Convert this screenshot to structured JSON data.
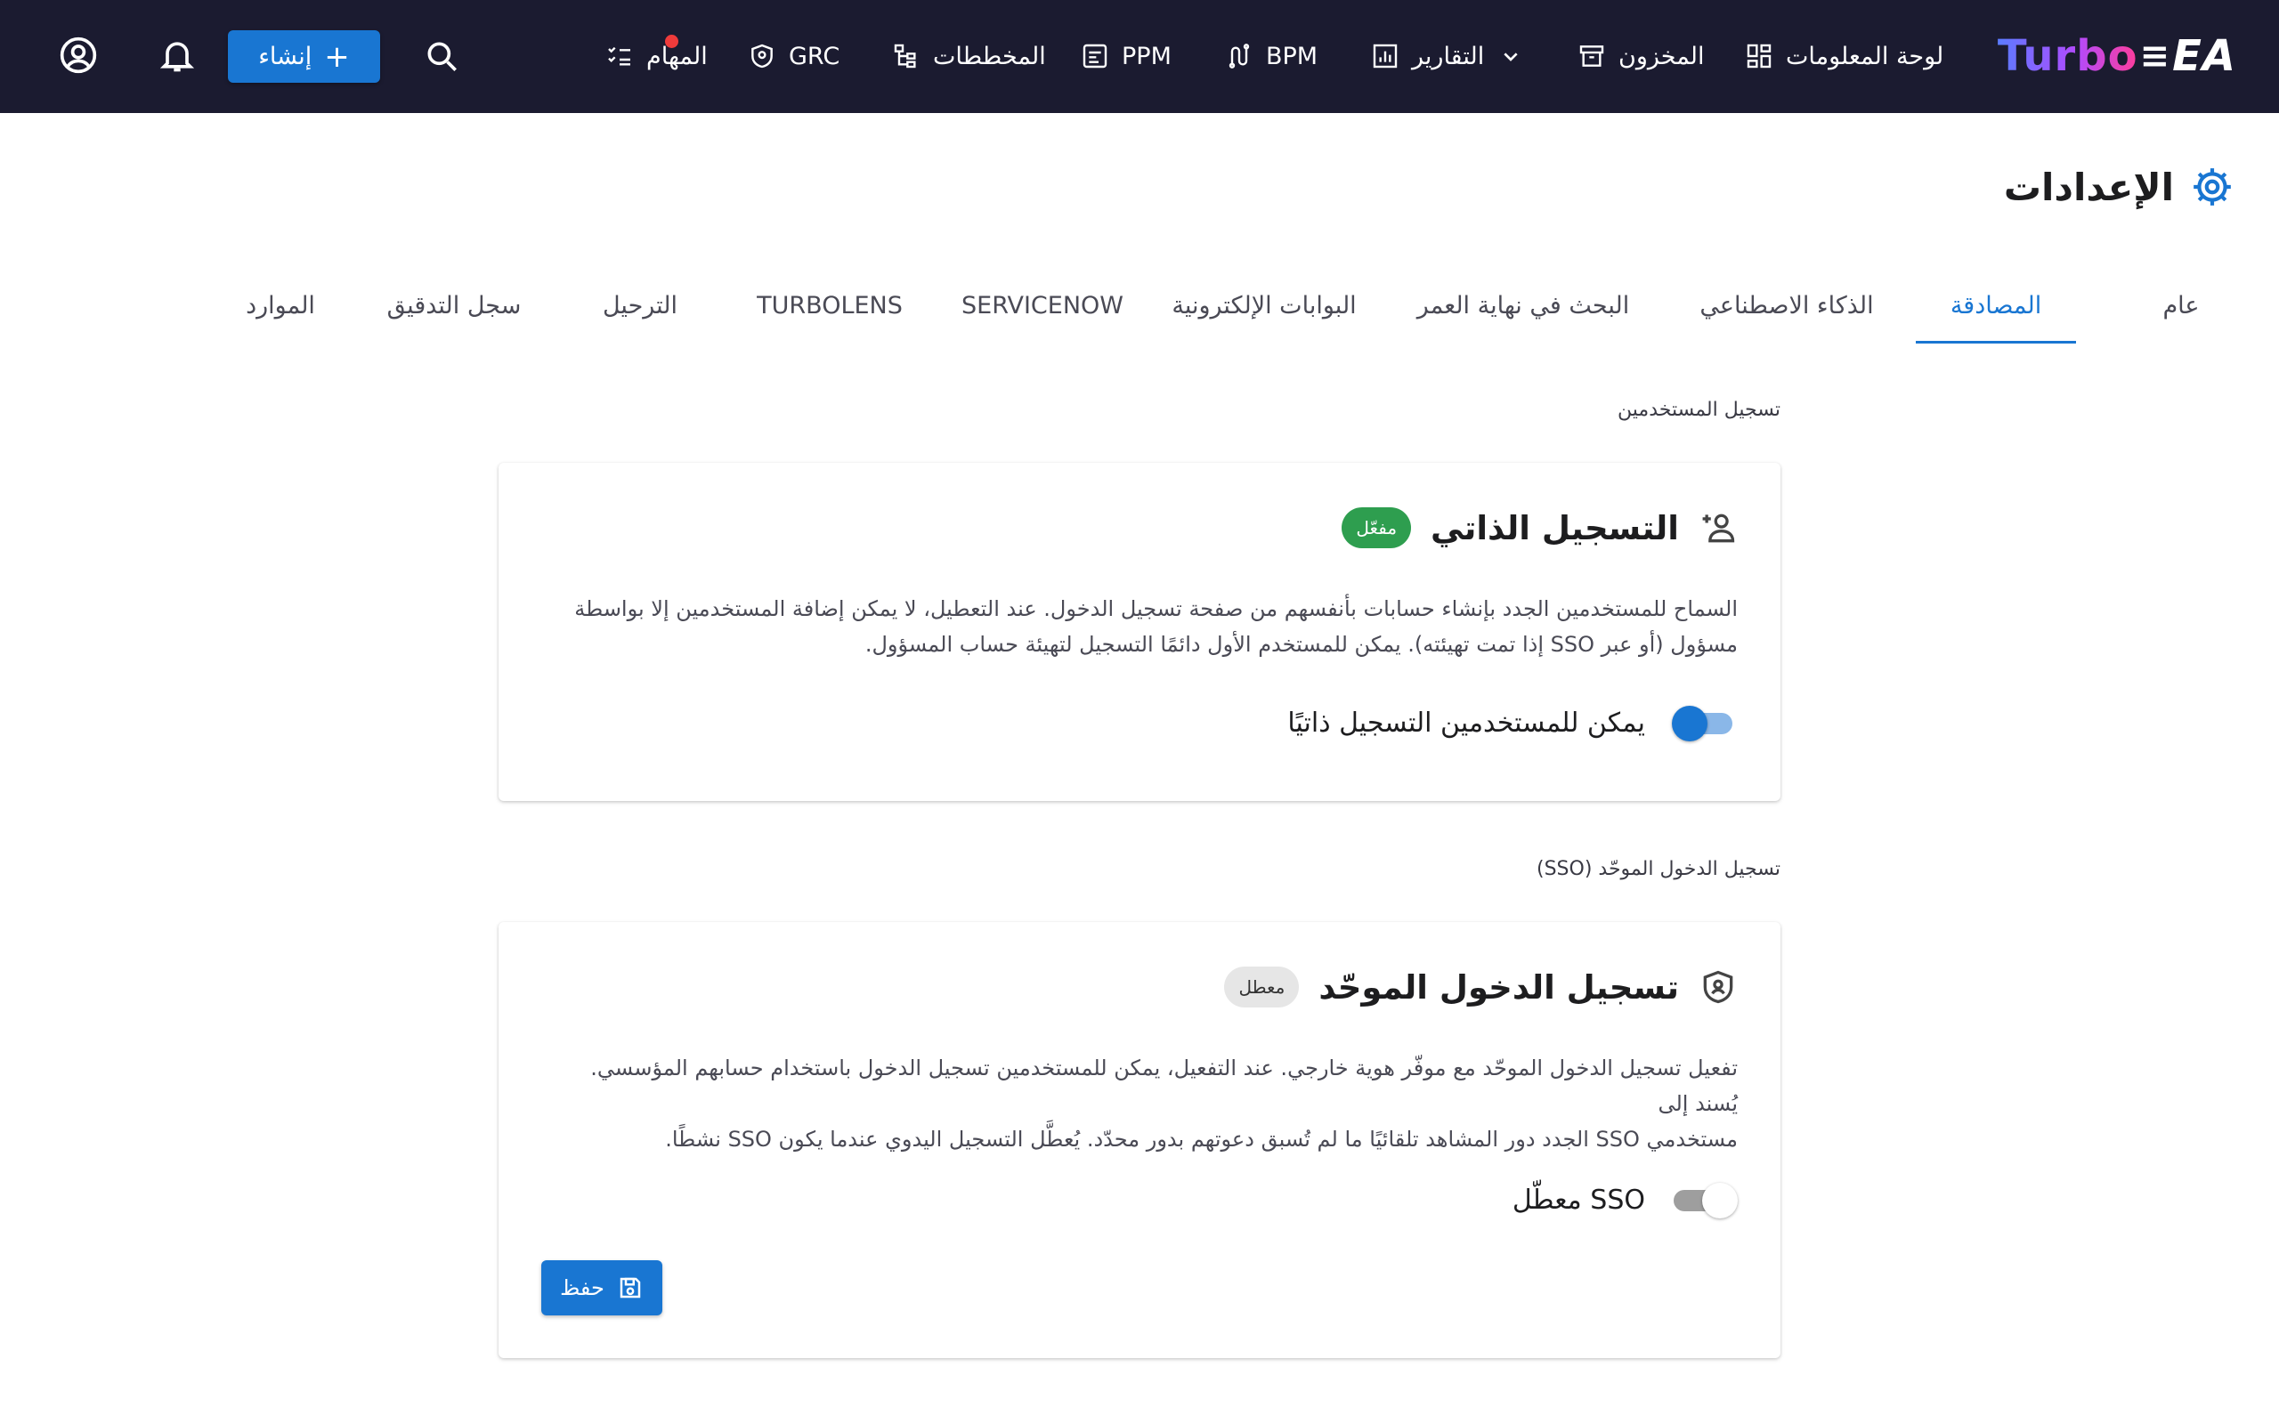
{
  "app": {
    "logo_part1": "Turbo",
    "logo_part2": "EA"
  },
  "nav": {
    "dashboard": "لوحة المعلومات",
    "inventory": "المخزون",
    "reports": "التقارير",
    "bpm": "BPM",
    "ppm": "PPM",
    "diagrams": "المخططات",
    "grc": "GRC",
    "tasks": "المهام",
    "create": "إنشاء"
  },
  "page": {
    "title": "الإعدادات"
  },
  "tabs": [
    {
      "label": "عام"
    },
    {
      "label": "المصادقة",
      "active": true
    },
    {
      "label": "الذكاء الاصطناعي"
    },
    {
      "label": "البحث في نهاية العمر"
    },
    {
      "label": "البوابات الإلكترونية"
    },
    {
      "label": "SERVICENOW"
    },
    {
      "label": "TURBOLENS"
    },
    {
      "label": "الترحيل"
    },
    {
      "label": "سجل التدقيق"
    },
    {
      "label": "الموارد"
    }
  ],
  "registration": {
    "section_label": "تسجيل المستخدمين",
    "title": "التسجيل الذاتي",
    "status": "مفعّل",
    "description_line1": "السماح للمستخدمين الجدد بإنشاء حسابات بأنفسهم من صفحة تسجيل الدخول. عند التعطيل، لا يمكن إضافة المستخدمين إلا بواسطة",
    "description_line2": "مسؤول (أو عبر SSO إذا تمت تهيئته). يمكن للمستخدم الأول دائمًا التسجيل لتهيئة حساب المسؤول.",
    "toggle_label": "يمكن للمستخدمين التسجيل ذاتيًا",
    "toggle_on": true
  },
  "sso": {
    "section_label": "تسجيل الدخول الموحّد (SSO)",
    "title": "تسجيل الدخول الموحّد",
    "status": "معطل",
    "description_line1": "تفعيل تسجيل الدخول الموحّد مع موفّر هوية خارجي. عند التفعيل، يمكن للمستخدمين تسجيل الدخول باستخدام حسابهم المؤسسي. يُسند إلى",
    "description_line2": "مستخدمي SSO الجدد دور المشاهد تلقائيًا ما لم تُسبق دعوتهم بدور محدّد. يُعطَّل التسجيل اليدوي عندما يكون SSO نشطًا.",
    "toggle_label": "SSO معطّل",
    "toggle_on": false,
    "save_label": "حفظ"
  },
  "colors": {
    "accent": "#1976d2",
    "topbar": "#1b1b30",
    "enabled_badge": "#2e9e4f"
  }
}
